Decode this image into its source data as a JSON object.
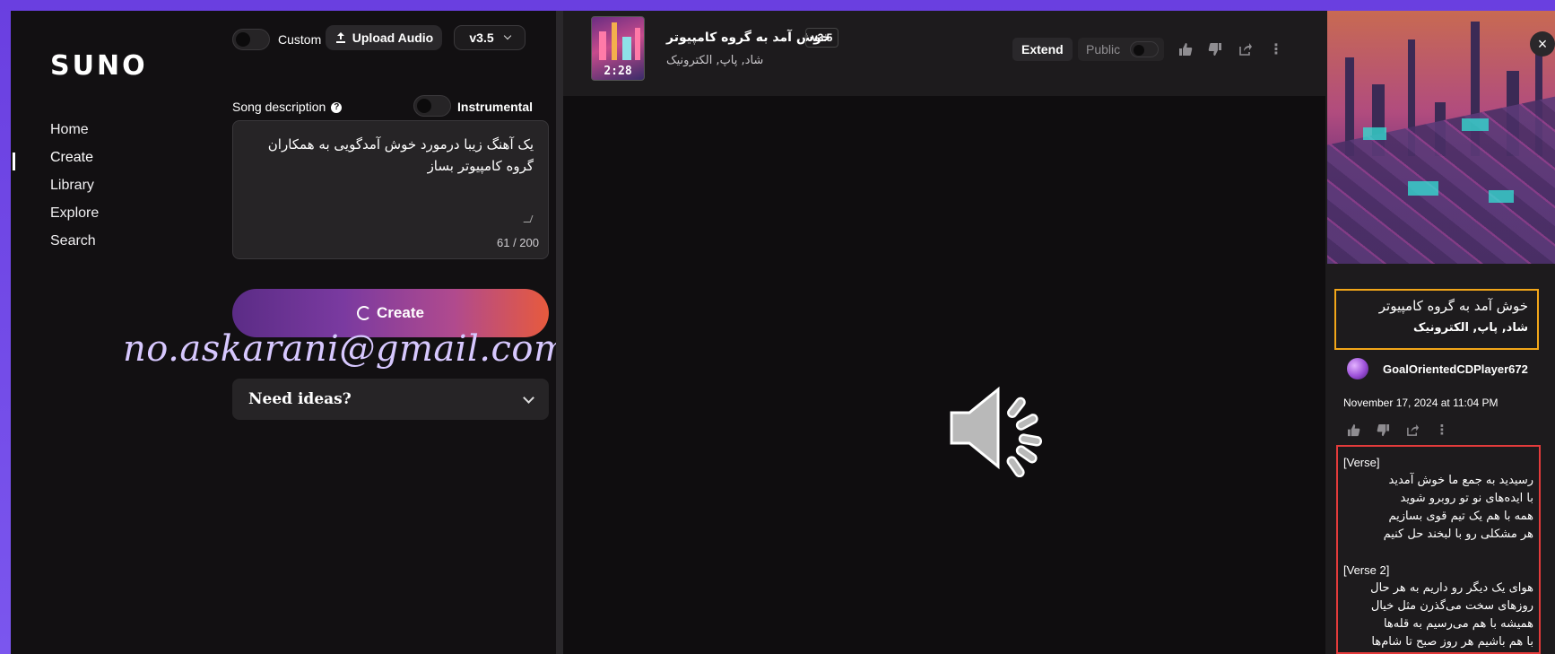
{
  "nav": {
    "logo": "SUNO",
    "items": [
      "Home",
      "Create",
      "Library",
      "Explore",
      "Search"
    ],
    "active": "Create"
  },
  "create_panel": {
    "custom_label": "Custom",
    "upload_audio_label": "Upload Audio",
    "model_version": "v3.5",
    "song_description_label": "Song description",
    "instrumental_label": "Instrumental",
    "song_description_value": "یک آهنگ زیبا درمورد خوش آمدگویی به همکاران گروه کامپیوتر بساز",
    "char_count": "61 / 200",
    "create_button": "Create",
    "need_ideas": "Need ideas?"
  },
  "watermark": "no.askarani@gmail.com",
  "song_bar": {
    "title": "خوش آمد به گروه کامپیوتر",
    "version_badge": "v3.5",
    "genre": "شاد, پاپ, الکترونیک",
    "duration": "2:28",
    "extend_label": "Extend",
    "public_label": "Public"
  },
  "details": {
    "title": "خوش آمد به گروه کامپیوتر",
    "genre": "شاد, پاپ, الکترونیک",
    "username": "GoalOrientedCDPlayer672",
    "date": "November 17, 2024 at 11:04 PM",
    "lyrics": [
      "[Verse]",
      "رسیدید به جمع ما خوش آمدید",
      "با ایده‌های نو تو روبرو شوید",
      "همه با هم یک تیم قوی بسازیم",
      "هر مشکلی رو با لبخند حل کنیم",
      "",
      "[Verse 2]",
      "هوای یک دیگر رو داریم به هر حال",
      "روزهای سخت می‌گذرن مثل خیال",
      "همیشه با هم می‌رسیم به قله‌ها",
      "با هم باشیم هر روز صبح تا شام‌ها"
    ]
  },
  "colors": {
    "frame_border": "#6a3fe0",
    "title_highlight": "#f2a619",
    "lyrics_highlight": "#e43b3b",
    "create_gradient_end": "#e75a3d"
  }
}
